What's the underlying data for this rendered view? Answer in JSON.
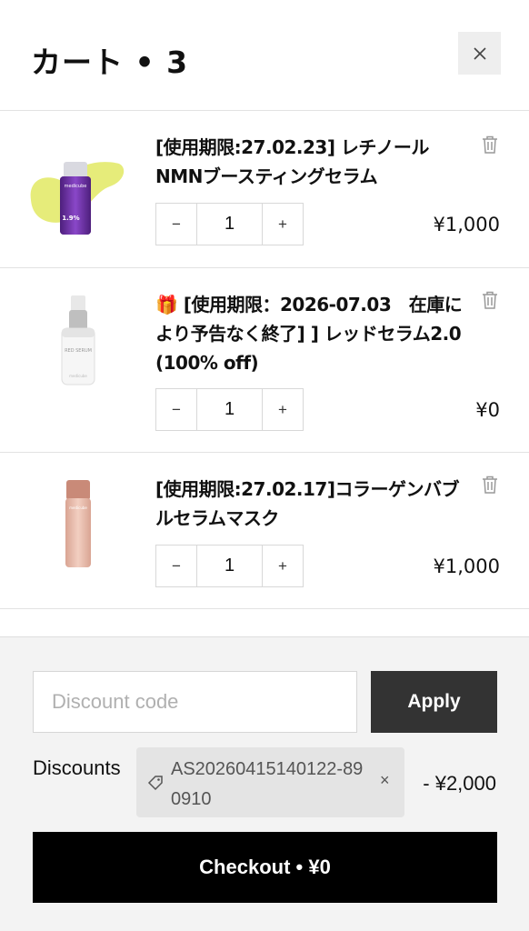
{
  "header": {
    "title": "カート • 3",
    "close_icon": "close-icon"
  },
  "items": [
    {
      "title": "[使用期限:27.02.23] レチノール NMNブースティングセラム",
      "quantity": "1",
      "price": "¥1,000",
      "minus": "−",
      "plus": "+"
    },
    {
      "title": "🎁 [使用期限：2026-07.03　在庫により予告なく終了] ] レッドセラム2.0 (100% off)",
      "quantity": "1",
      "price": "¥0",
      "minus": "−",
      "plus": "+"
    },
    {
      "title": "[使用期限:27.02.17]コラーゲンバブルセラムマスク",
      "quantity": "1",
      "price": "¥1,000",
      "minus": "−",
      "plus": "+"
    }
  ],
  "footer": {
    "discount_placeholder": "Discount code",
    "apply_label": "Apply",
    "discounts_label": "Discounts",
    "discount_code": "AS20260415140122-890910",
    "discount_remove": "×",
    "discount_amount": "- ¥2,000",
    "checkout_label": "Checkout • ¥0"
  },
  "colors": {
    "checkout_bg": "#000000",
    "apply_bg": "#333333",
    "footer_bg": "#f3f3f3"
  }
}
